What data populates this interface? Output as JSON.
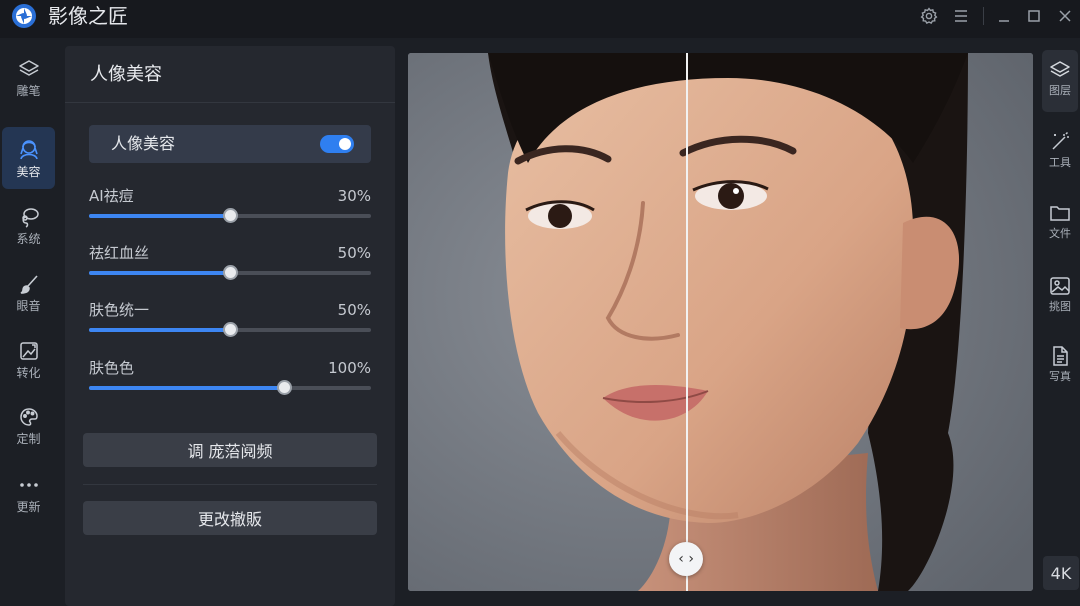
{
  "app": {
    "title": "影像之匠"
  },
  "titlebar": {
    "settings_icon": "gear-icon",
    "menu_icon": "menu-icon",
    "minimize_icon": "minimize-icon",
    "maximize_icon": "maximize-icon",
    "close_icon": "close-icon"
  },
  "left_rail": {
    "items": [
      {
        "label": "雕笔",
        "icon": "layers-icon",
        "active": false
      },
      {
        "label": "美容",
        "icon": "portrait-icon",
        "active": true
      },
      {
        "label": "系统",
        "icon": "lasso-icon",
        "active": false
      },
      {
        "label": "眼音",
        "icon": "brush-icon",
        "active": false
      },
      {
        "label": "转化",
        "icon": "transform-icon",
        "active": false
      },
      {
        "label": "定制",
        "icon": "palette-icon",
        "active": false
      },
      {
        "label": "更新",
        "icon": "more-icon",
        "active": false
      }
    ]
  },
  "panel": {
    "title": "人像美容",
    "toggle": {
      "label": "人像美容",
      "on": true
    },
    "sliders": [
      {
        "label": "AI祛痘",
        "value_text": "30%",
        "value": 0.5
      },
      {
        "label": "祛红血丝",
        "value_text": "50%",
        "value": 0.5
      },
      {
        "label": "肤色统一",
        "value_text": "50%",
        "value": 0.5
      },
      {
        "label": "肤色色",
        "value_text": "100%",
        "value": 0.69
      }
    ],
    "buttons": {
      "primary": "调 庞菭阋频",
      "secondary": "更改撤販"
    }
  },
  "canvas": {
    "compare_split": 0.445
  },
  "right_rail": {
    "items": [
      {
        "label": "图层",
        "icon": "layers-icon",
        "active": true
      },
      {
        "label": "工具",
        "icon": "magic-wand-icon",
        "active": false
      },
      {
        "label": "文件",
        "icon": "folder-icon",
        "active": false
      },
      {
        "label": "挑图",
        "icon": "image-icon",
        "active": false
      },
      {
        "label": "写真",
        "icon": "document-icon",
        "active": false
      }
    ],
    "badge": "4K"
  },
  "colors": {
    "accent": "#2f7ff0",
    "active_rail": "#243653",
    "panel_bg": "#25282f",
    "app_bg": "#1c1f25"
  }
}
